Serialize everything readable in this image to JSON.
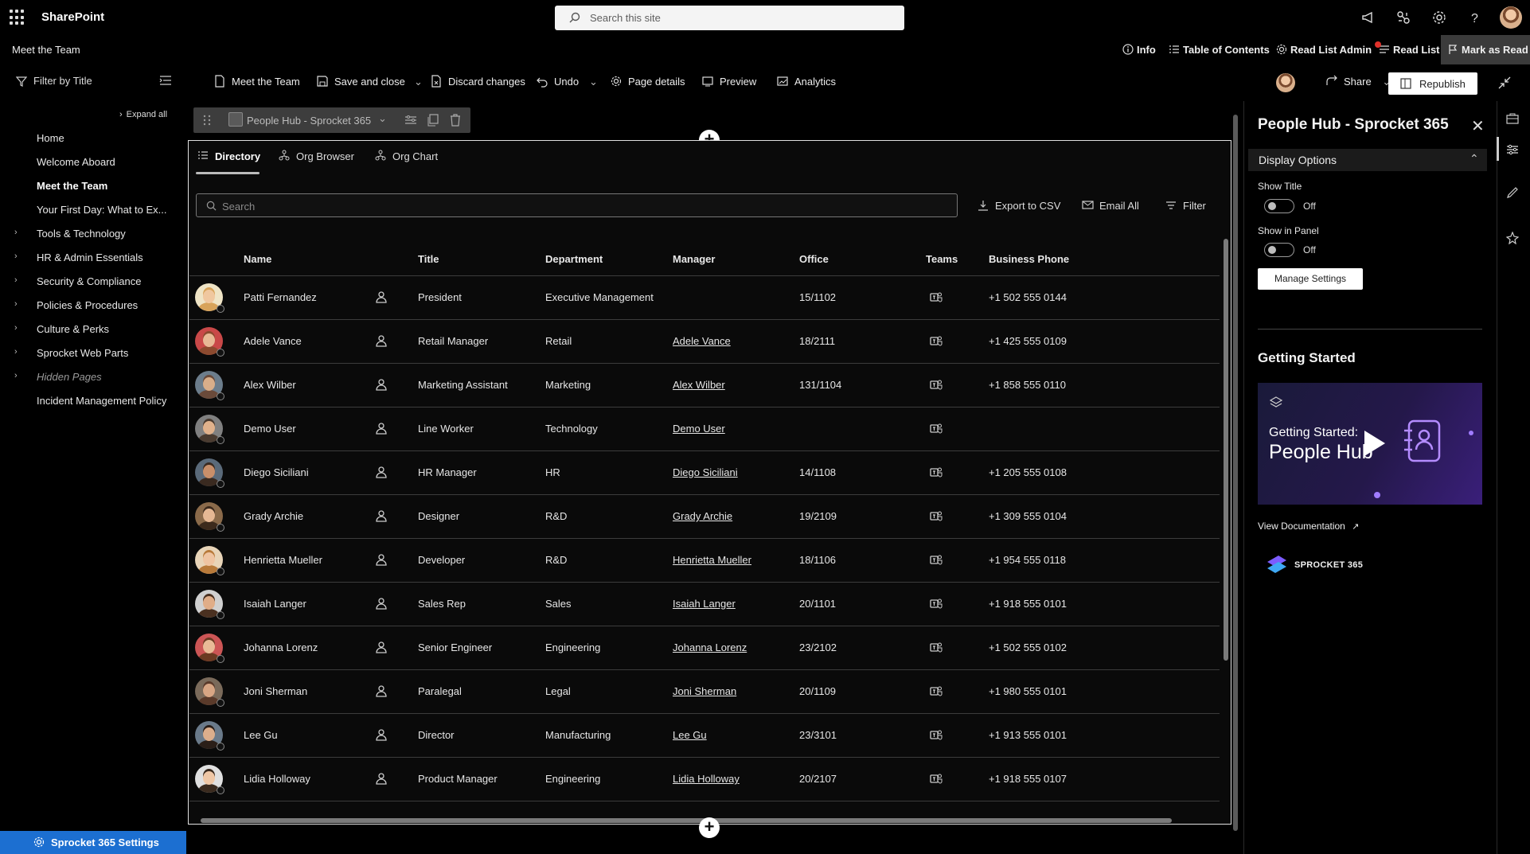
{
  "app": {
    "name": "SharePoint",
    "search_placeholder": "Search this site"
  },
  "site": {
    "title": "Meet the Team",
    "actions": {
      "info": "Info",
      "toc": "Table of Contents",
      "read_list_admin": "Read List Admin",
      "read_list": "Read List",
      "mark_read": "Mark as Read"
    }
  },
  "nav": {
    "filter": "Filter by Title",
    "expand_all": "Expand all",
    "items": [
      {
        "label": "Home"
      },
      {
        "label": "Welcome Aboard"
      },
      {
        "label": "Meet the Team"
      },
      {
        "label": "Your First Day: What to Ex..."
      },
      {
        "label": "Tools & Technology"
      },
      {
        "label": "HR & Admin Essentials"
      },
      {
        "label": "Security & Compliance"
      },
      {
        "label": "Policies & Procedures"
      },
      {
        "label": "Culture & Perks"
      },
      {
        "label": "Sprocket Web Parts"
      },
      {
        "label": "Hidden Pages"
      },
      {
        "label": "Incident Management Policy"
      }
    ],
    "settings_button": "Sprocket 365 Settings"
  },
  "toolbar": {
    "page": "Meet the Team",
    "save": "Save and close",
    "discard": "Discard changes",
    "undo": "Undo",
    "page_details": "Page details",
    "preview": "Preview",
    "analytics": "Analytics",
    "share": "Share",
    "republish": "Republish"
  },
  "webpart": {
    "name": "People Hub - Sprocket 365",
    "tabs": [
      {
        "label": "Directory"
      },
      {
        "label": "Org Browser"
      },
      {
        "label": "Org Chart"
      }
    ],
    "search_placeholder": "Search",
    "actions": {
      "export": "Export to CSV",
      "email": "Email All",
      "filter": "Filter"
    },
    "columns": {
      "name": "Name",
      "title": "Title",
      "department": "Department",
      "manager": "Manager",
      "office": "Office",
      "teams": "Teams",
      "phone": "Business Phone"
    },
    "rows": [
      {
        "name": "Patti Fernandez",
        "title": "President",
        "department": "Executive Management",
        "manager": "",
        "office": "15/1102",
        "phone": "+1 502 555 0144"
      },
      {
        "name": "Adele Vance",
        "title": "Retail Manager",
        "department": "Retail",
        "manager": "Adele Vance",
        "office": "18/2111",
        "phone": "+1 425 555 0109"
      },
      {
        "name": "Alex Wilber",
        "title": "Marketing Assistant",
        "department": "Marketing",
        "manager": "Alex Wilber",
        "office": "131/1104",
        "phone": "+1 858 555 0110"
      },
      {
        "name": "Demo User",
        "title": "Line Worker",
        "department": "Technology",
        "manager": "Demo User",
        "office": "",
        "phone": ""
      },
      {
        "name": "Diego Siciliani",
        "title": "HR Manager",
        "department": "HR",
        "manager": "Diego Siciliani",
        "office": "14/1108",
        "phone": "+1 205 555 0108"
      },
      {
        "name": "Grady Archie",
        "title": "Designer",
        "department": "R&D",
        "manager": "Grady Archie",
        "office": "19/2109",
        "phone": "+1 309 555 0104"
      },
      {
        "name": "Henrietta Mueller",
        "title": "Developer",
        "department": "R&D",
        "manager": "Henrietta Mueller",
        "office": "18/1106",
        "phone": "+1 954 555 0118"
      },
      {
        "name": "Isaiah Langer",
        "title": "Sales Rep",
        "department": "Sales",
        "manager": "Isaiah Langer",
        "office": "20/1101",
        "phone": "+1 918 555 0101"
      },
      {
        "name": "Johanna Lorenz",
        "title": "Senior Engineer",
        "department": "Engineering",
        "manager": "Johanna Lorenz",
        "office": "23/2102",
        "phone": "+1 502 555 0102"
      },
      {
        "name": "Joni Sherman",
        "title": "Paralegal",
        "department": "Legal",
        "manager": "Joni Sherman",
        "office": "20/1109",
        "phone": "+1 980 555 0101"
      },
      {
        "name": "Lee Gu",
        "title": "Director",
        "department": "Manufacturing",
        "manager": "Lee Gu",
        "office": "23/3101",
        "phone": "+1 913 555 0101"
      },
      {
        "name": "Lidia Holloway",
        "title": "Product Manager",
        "department": "Engineering",
        "manager": "Lidia Holloway",
        "office": "20/2107",
        "phone": "+1 918 555 0107"
      }
    ]
  },
  "panel": {
    "title": "People Hub - Sprocket 365",
    "section": "Display Options",
    "show_title": "Show Title",
    "show_title_state": "Off",
    "show_in_panel": "Show in Panel",
    "show_in_panel_state": "Off",
    "manage": "Manage Settings",
    "getting_started": "Getting Started",
    "video_line1": "Getting Started:",
    "video_line2": "People Hub",
    "view_docs": "View Documentation",
    "brand": "SPROCKET 365"
  },
  "colors": {
    "accent": "#1c6fd1",
    "background": "#000000"
  }
}
